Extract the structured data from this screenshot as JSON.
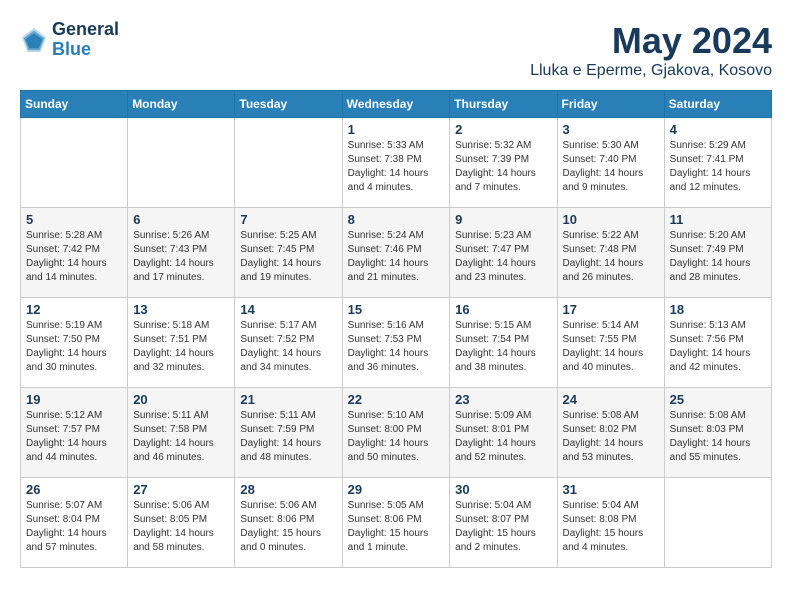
{
  "logo": {
    "line1": "General",
    "line2": "Blue"
  },
  "title": "May 2024",
  "location": "Lluka e Eperme, Gjakova, Kosovo",
  "weekdays": [
    "Sunday",
    "Monday",
    "Tuesday",
    "Wednesday",
    "Thursday",
    "Friday",
    "Saturday"
  ],
  "weeks": [
    [
      {
        "day": "",
        "sunrise": "",
        "sunset": "",
        "daylight": ""
      },
      {
        "day": "",
        "sunrise": "",
        "sunset": "",
        "daylight": ""
      },
      {
        "day": "",
        "sunrise": "",
        "sunset": "",
        "daylight": ""
      },
      {
        "day": "1",
        "sunrise": "Sunrise: 5:33 AM",
        "sunset": "Sunset: 7:38 PM",
        "daylight": "Daylight: 14 hours and 4 minutes."
      },
      {
        "day": "2",
        "sunrise": "Sunrise: 5:32 AM",
        "sunset": "Sunset: 7:39 PM",
        "daylight": "Daylight: 14 hours and 7 minutes."
      },
      {
        "day": "3",
        "sunrise": "Sunrise: 5:30 AM",
        "sunset": "Sunset: 7:40 PM",
        "daylight": "Daylight: 14 hours and 9 minutes."
      },
      {
        "day": "4",
        "sunrise": "Sunrise: 5:29 AM",
        "sunset": "Sunset: 7:41 PM",
        "daylight": "Daylight: 14 hours and 12 minutes."
      }
    ],
    [
      {
        "day": "5",
        "sunrise": "Sunrise: 5:28 AM",
        "sunset": "Sunset: 7:42 PM",
        "daylight": "Daylight: 14 hours and 14 minutes."
      },
      {
        "day": "6",
        "sunrise": "Sunrise: 5:26 AM",
        "sunset": "Sunset: 7:43 PM",
        "daylight": "Daylight: 14 hours and 17 minutes."
      },
      {
        "day": "7",
        "sunrise": "Sunrise: 5:25 AM",
        "sunset": "Sunset: 7:45 PM",
        "daylight": "Daylight: 14 hours and 19 minutes."
      },
      {
        "day": "8",
        "sunrise": "Sunrise: 5:24 AM",
        "sunset": "Sunset: 7:46 PM",
        "daylight": "Daylight: 14 hours and 21 minutes."
      },
      {
        "day": "9",
        "sunrise": "Sunrise: 5:23 AM",
        "sunset": "Sunset: 7:47 PM",
        "daylight": "Daylight: 14 hours and 23 minutes."
      },
      {
        "day": "10",
        "sunrise": "Sunrise: 5:22 AM",
        "sunset": "Sunset: 7:48 PM",
        "daylight": "Daylight: 14 hours and 26 minutes."
      },
      {
        "day": "11",
        "sunrise": "Sunrise: 5:20 AM",
        "sunset": "Sunset: 7:49 PM",
        "daylight": "Daylight: 14 hours and 28 minutes."
      }
    ],
    [
      {
        "day": "12",
        "sunrise": "Sunrise: 5:19 AM",
        "sunset": "Sunset: 7:50 PM",
        "daylight": "Daylight: 14 hours and 30 minutes."
      },
      {
        "day": "13",
        "sunrise": "Sunrise: 5:18 AM",
        "sunset": "Sunset: 7:51 PM",
        "daylight": "Daylight: 14 hours and 32 minutes."
      },
      {
        "day": "14",
        "sunrise": "Sunrise: 5:17 AM",
        "sunset": "Sunset: 7:52 PM",
        "daylight": "Daylight: 14 hours and 34 minutes."
      },
      {
        "day": "15",
        "sunrise": "Sunrise: 5:16 AM",
        "sunset": "Sunset: 7:53 PM",
        "daylight": "Daylight: 14 hours and 36 minutes."
      },
      {
        "day": "16",
        "sunrise": "Sunrise: 5:15 AM",
        "sunset": "Sunset: 7:54 PM",
        "daylight": "Daylight: 14 hours and 38 minutes."
      },
      {
        "day": "17",
        "sunrise": "Sunrise: 5:14 AM",
        "sunset": "Sunset: 7:55 PM",
        "daylight": "Daylight: 14 hours and 40 minutes."
      },
      {
        "day": "18",
        "sunrise": "Sunrise: 5:13 AM",
        "sunset": "Sunset: 7:56 PM",
        "daylight": "Daylight: 14 hours and 42 minutes."
      }
    ],
    [
      {
        "day": "19",
        "sunrise": "Sunrise: 5:12 AM",
        "sunset": "Sunset: 7:57 PM",
        "daylight": "Daylight: 14 hours and 44 minutes."
      },
      {
        "day": "20",
        "sunrise": "Sunrise: 5:11 AM",
        "sunset": "Sunset: 7:58 PM",
        "daylight": "Daylight: 14 hours and 46 minutes."
      },
      {
        "day": "21",
        "sunrise": "Sunrise: 5:11 AM",
        "sunset": "Sunset: 7:59 PM",
        "daylight": "Daylight: 14 hours and 48 minutes."
      },
      {
        "day": "22",
        "sunrise": "Sunrise: 5:10 AM",
        "sunset": "Sunset: 8:00 PM",
        "daylight": "Daylight: 14 hours and 50 minutes."
      },
      {
        "day": "23",
        "sunrise": "Sunrise: 5:09 AM",
        "sunset": "Sunset: 8:01 PM",
        "daylight": "Daylight: 14 hours and 52 minutes."
      },
      {
        "day": "24",
        "sunrise": "Sunrise: 5:08 AM",
        "sunset": "Sunset: 8:02 PM",
        "daylight": "Daylight: 14 hours and 53 minutes."
      },
      {
        "day": "25",
        "sunrise": "Sunrise: 5:08 AM",
        "sunset": "Sunset: 8:03 PM",
        "daylight": "Daylight: 14 hours and 55 minutes."
      }
    ],
    [
      {
        "day": "26",
        "sunrise": "Sunrise: 5:07 AM",
        "sunset": "Sunset: 8:04 PM",
        "daylight": "Daylight: 14 hours and 57 minutes."
      },
      {
        "day": "27",
        "sunrise": "Sunrise: 5:06 AM",
        "sunset": "Sunset: 8:05 PM",
        "daylight": "Daylight: 14 hours and 58 minutes."
      },
      {
        "day": "28",
        "sunrise": "Sunrise: 5:06 AM",
        "sunset": "Sunset: 8:06 PM",
        "daylight": "Daylight: 15 hours and 0 minutes."
      },
      {
        "day": "29",
        "sunrise": "Sunrise: 5:05 AM",
        "sunset": "Sunset: 8:06 PM",
        "daylight": "Daylight: 15 hours and 1 minute."
      },
      {
        "day": "30",
        "sunrise": "Sunrise: 5:04 AM",
        "sunset": "Sunset: 8:07 PM",
        "daylight": "Daylight: 15 hours and 2 minutes."
      },
      {
        "day": "31",
        "sunrise": "Sunrise: 5:04 AM",
        "sunset": "Sunset: 8:08 PM",
        "daylight": "Daylight: 15 hours and 4 minutes."
      },
      {
        "day": "",
        "sunrise": "",
        "sunset": "",
        "daylight": ""
      }
    ]
  ]
}
